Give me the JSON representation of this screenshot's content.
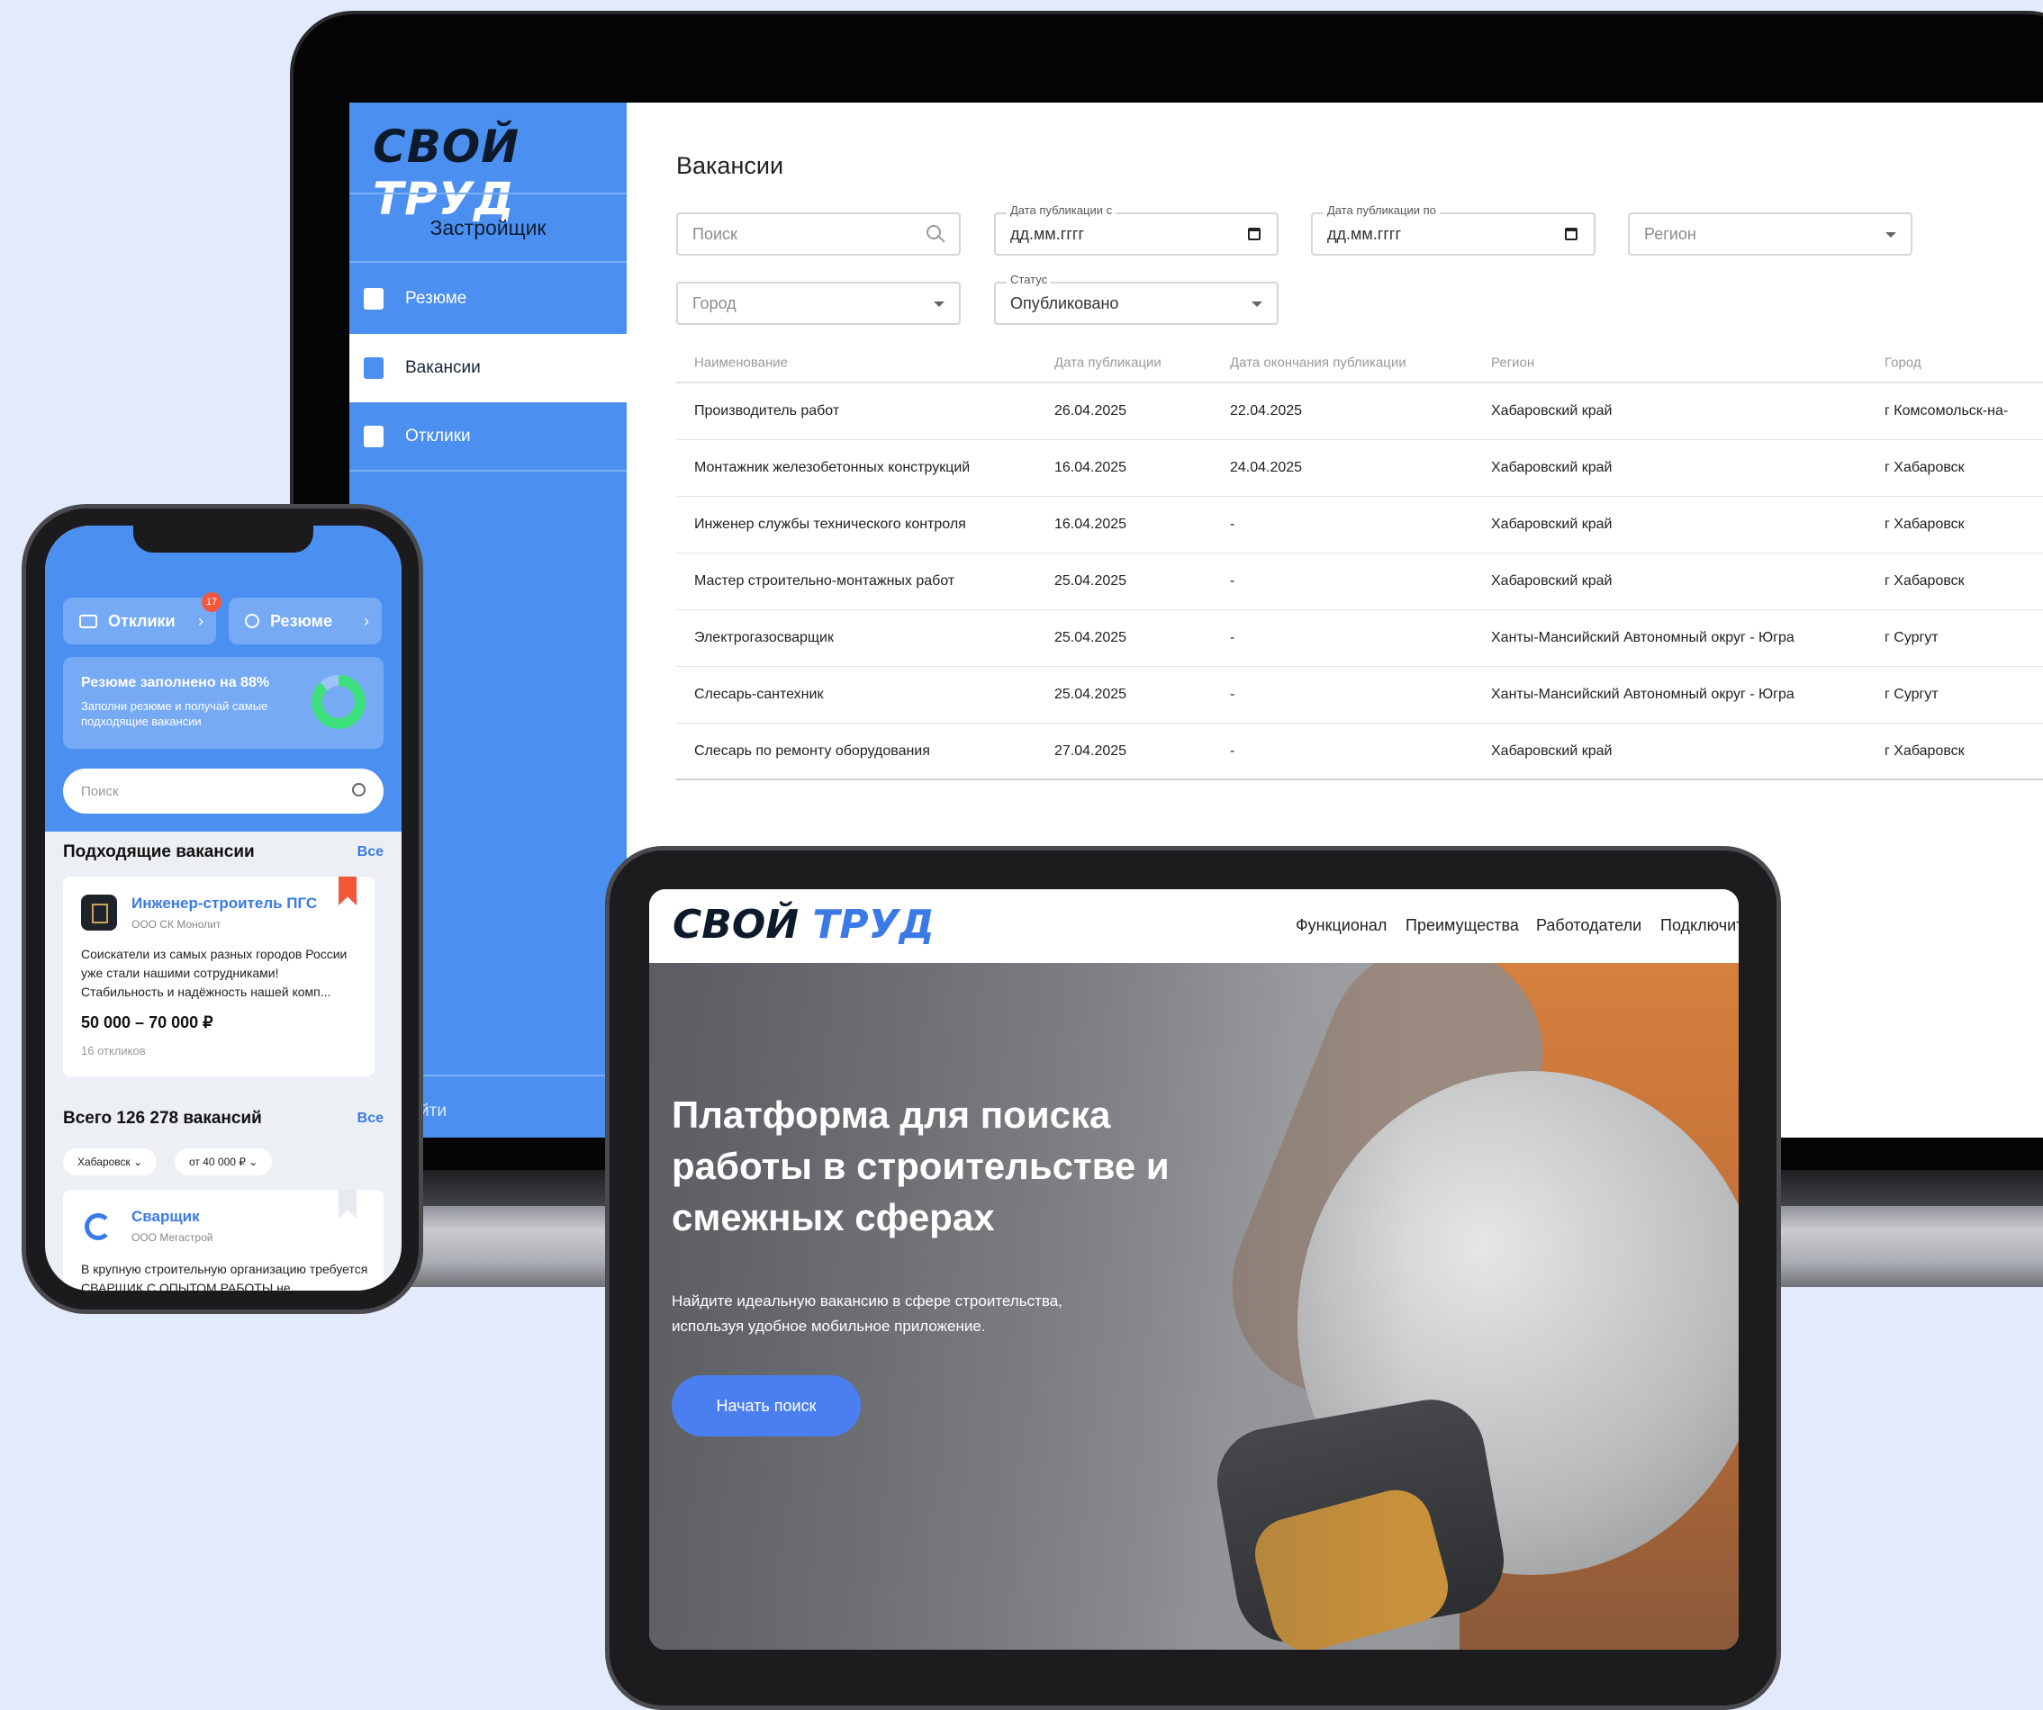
{
  "laptop": {
    "logo": {
      "part1": "СВОЙ",
      "part2": "ТРУД"
    },
    "sidebar": {
      "role": "Застройщик",
      "items": [
        {
          "label": "Резюме",
          "icon": "document-icon"
        },
        {
          "label": "Вакансии",
          "icon": "briefcase-icon",
          "active": true
        },
        {
          "label": "Отклики",
          "icon": "file-check-icon"
        }
      ],
      "exit_label": "йти"
    },
    "page_title": "Вакансии",
    "filters": {
      "search_placeholder": "Поиск",
      "date_from_label": "Дата публикации с",
      "date_from_value": "дд.мм.гггг",
      "date_to_label": "Дата публикации по",
      "date_to_value": "дд.мм.гггг",
      "region_placeholder": "Регион",
      "city_placeholder": "Город",
      "status_label": "Статус",
      "status_value": "Опубликовано"
    },
    "table": {
      "headers": [
        "Наименование",
        "Дата публикации",
        "Дата окончания публикации",
        "Регион",
        "Город"
      ],
      "rows": [
        [
          "Производитель работ",
          "26.04.2025",
          "22.04.2025",
          "Хабаровский край",
          "г Комсомольск-на-"
        ],
        [
          "Монтажник железобетонных конструкций",
          "16.04.2025",
          "24.04.2025",
          "Хабаровский край",
          "г Хабаровск"
        ],
        [
          "Инженер службы технического контроля",
          "16.04.2025",
          "-",
          "Хабаровский край",
          "г Хабаровск"
        ],
        [
          "Мастер строительно-монтажных работ",
          "25.04.2025",
          "-",
          "Хабаровский край",
          "г Хабаровск"
        ],
        [
          "Электрогазосварщик",
          "25.04.2025",
          "-",
          "Ханты-Мансийский Автономный округ - Югра",
          "г Сургут"
        ],
        [
          "Слесарь-сантехник",
          "25.04.2025",
          "-",
          "Ханты-Мансийский Автономный округ - Югра",
          "г Сургут"
        ],
        [
          "Слесарь по ремонту оборудования",
          "27.04.2025",
          "-",
          "Хабаровский край",
          "г Хабаровск"
        ]
      ]
    }
  },
  "phone": {
    "otkliki_label": "Отклики",
    "otkliki_badge": "17",
    "resume_label": "Резюме",
    "chevron": "›",
    "fill_title": "Резюме заполнено на 88%",
    "fill_subtitle": "Заполни резюме и получай самые подходящие вакансии",
    "fill_percent": 88,
    "search_placeholder": "Поиск",
    "matching_title": "Подходящие вакансии",
    "all_label": "Все",
    "card1": {
      "title": "Инженер-строитель ПГС",
      "company": "ООО СК Монолит",
      "description": "Соискатели из самых разных городов России уже стали нашими сотрудниками! Стабильность и надёжность нашей комп...",
      "salary": "50 000 – 70 000 ₽",
      "responses": "16 откликов"
    },
    "total_title": "Всего 126 278 вакансий",
    "chip_city": "Хабаровск ⌄",
    "chip_salary": "от 40 000 ₽ ⌄",
    "card2": {
      "title": "Сварщик",
      "company": "ООО Мегастрой",
      "description": "В крупную строительную организацию требуется СВАРЩИК С ОПЫТОМ РАБОТЫ не"
    }
  },
  "tablet": {
    "logo": {
      "part1": "СВОЙ",
      "part2": "ТРУД"
    },
    "nav": [
      "Функционал",
      "Преимущества",
      "Работодатели",
      "Подключит"
    ],
    "hero_title": "Платформа для поиска работы в строительстве и смежных сферах",
    "hero_text": "Найдите идеальную вакансию в сфере строительства, используя удобное мобильное приложение.",
    "cta_label": "Начать поиск"
  },
  "colors": {
    "brand_blue": "#4b8ff0",
    "accent_blue": "#3a7ae6",
    "badge_red": "#f2563b",
    "progress_green": "#3ee07d"
  }
}
